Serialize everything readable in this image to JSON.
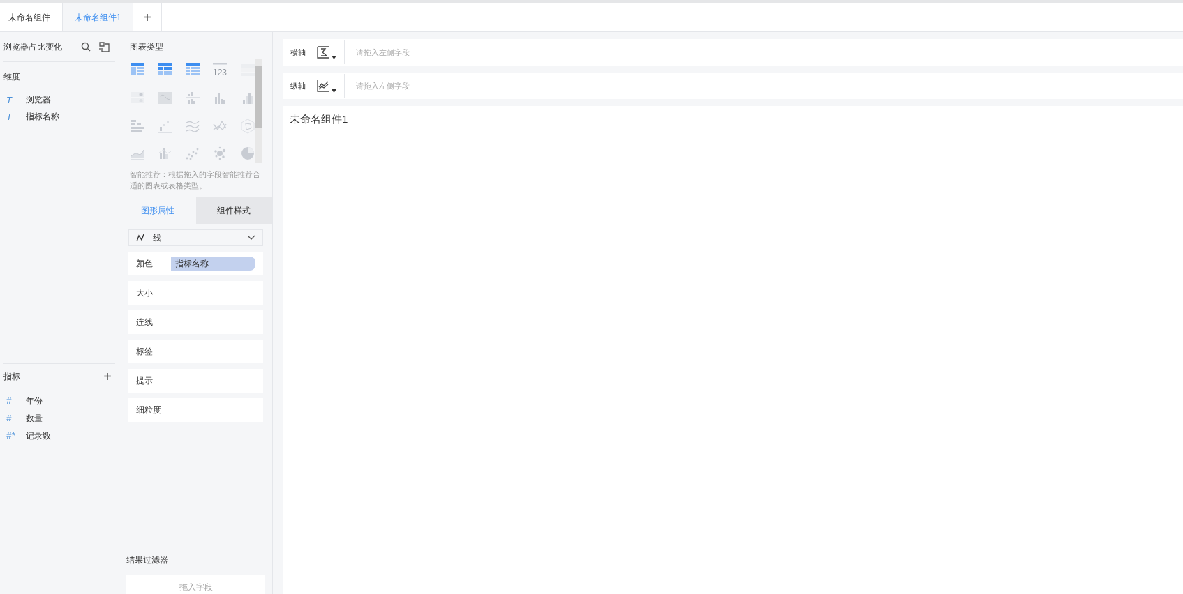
{
  "tabs": [
    {
      "label": "未命名组件",
      "selected": false
    },
    {
      "label": "未命名组件1",
      "selected": true
    }
  ],
  "add_tab": "+",
  "dataset": {
    "title": "浏览器占比变化"
  },
  "dimensions": {
    "title": "维度",
    "items": [
      {
        "type_icon": "T",
        "label": "浏览器"
      },
      {
        "type_icon": "T",
        "label": "指标名称"
      }
    ]
  },
  "measures": {
    "title": "指标",
    "add": "+",
    "items": [
      {
        "type_icon": "#",
        "label": "年份"
      },
      {
        "type_icon": "#",
        "label": "数量"
      },
      {
        "type_icon": "#*",
        "label": "记录数"
      }
    ]
  },
  "chart_types": {
    "title": "图表类型",
    "items": [
      {
        "kind": "table-group",
        "enabled": true
      },
      {
        "kind": "table-cross",
        "enabled": true
      },
      {
        "kind": "table-detail",
        "enabled": true
      },
      {
        "kind": "kpi",
        "enabled": false,
        "label": "123"
      },
      {
        "kind": "card-list",
        "enabled": false
      },
      {
        "kind": "card-dots",
        "enabled": false
      },
      {
        "kind": "map",
        "enabled": false
      },
      {
        "kind": "bar-split",
        "enabled": false
      },
      {
        "kind": "column",
        "enabled": false
      },
      {
        "kind": "column-rise",
        "enabled": false
      },
      {
        "kind": "bar-h",
        "enabled": false
      },
      {
        "kind": "step",
        "enabled": false
      },
      {
        "kind": "line-multi",
        "enabled": false
      },
      {
        "kind": "line-cross",
        "enabled": false
      },
      {
        "kind": "radar",
        "enabled": false
      },
      {
        "kind": "area",
        "enabled": false
      },
      {
        "kind": "combo",
        "enabled": false
      },
      {
        "kind": "scatter",
        "enabled": false
      },
      {
        "kind": "bubble",
        "enabled": false
      },
      {
        "kind": "pie",
        "enabled": false
      }
    ],
    "hint": "智能推荐：根据拖入的字段智能推荐合适的图表或表格类型。"
  },
  "property_tabs": [
    {
      "label": "图形属性",
      "selected": true
    },
    {
      "label": "组件样式",
      "selected": false
    }
  ],
  "mark_type": "线",
  "properties": [
    {
      "label": "颜色",
      "field": "指标名称"
    },
    {
      "label": "大小"
    },
    {
      "label": "连线"
    },
    {
      "label": "标签"
    },
    {
      "label": "提示"
    },
    {
      "label": "细粒度"
    }
  ],
  "result_filter": {
    "title": "结果过滤器",
    "placeholder": "拖入字段"
  },
  "axes": [
    {
      "label": "横轴",
      "kind": "x",
      "placeholder": "请拖入左侧字段"
    },
    {
      "label": "纵轴",
      "kind": "y",
      "placeholder": "请拖入左侧字段"
    }
  ],
  "component_title": "未命名组件1"
}
